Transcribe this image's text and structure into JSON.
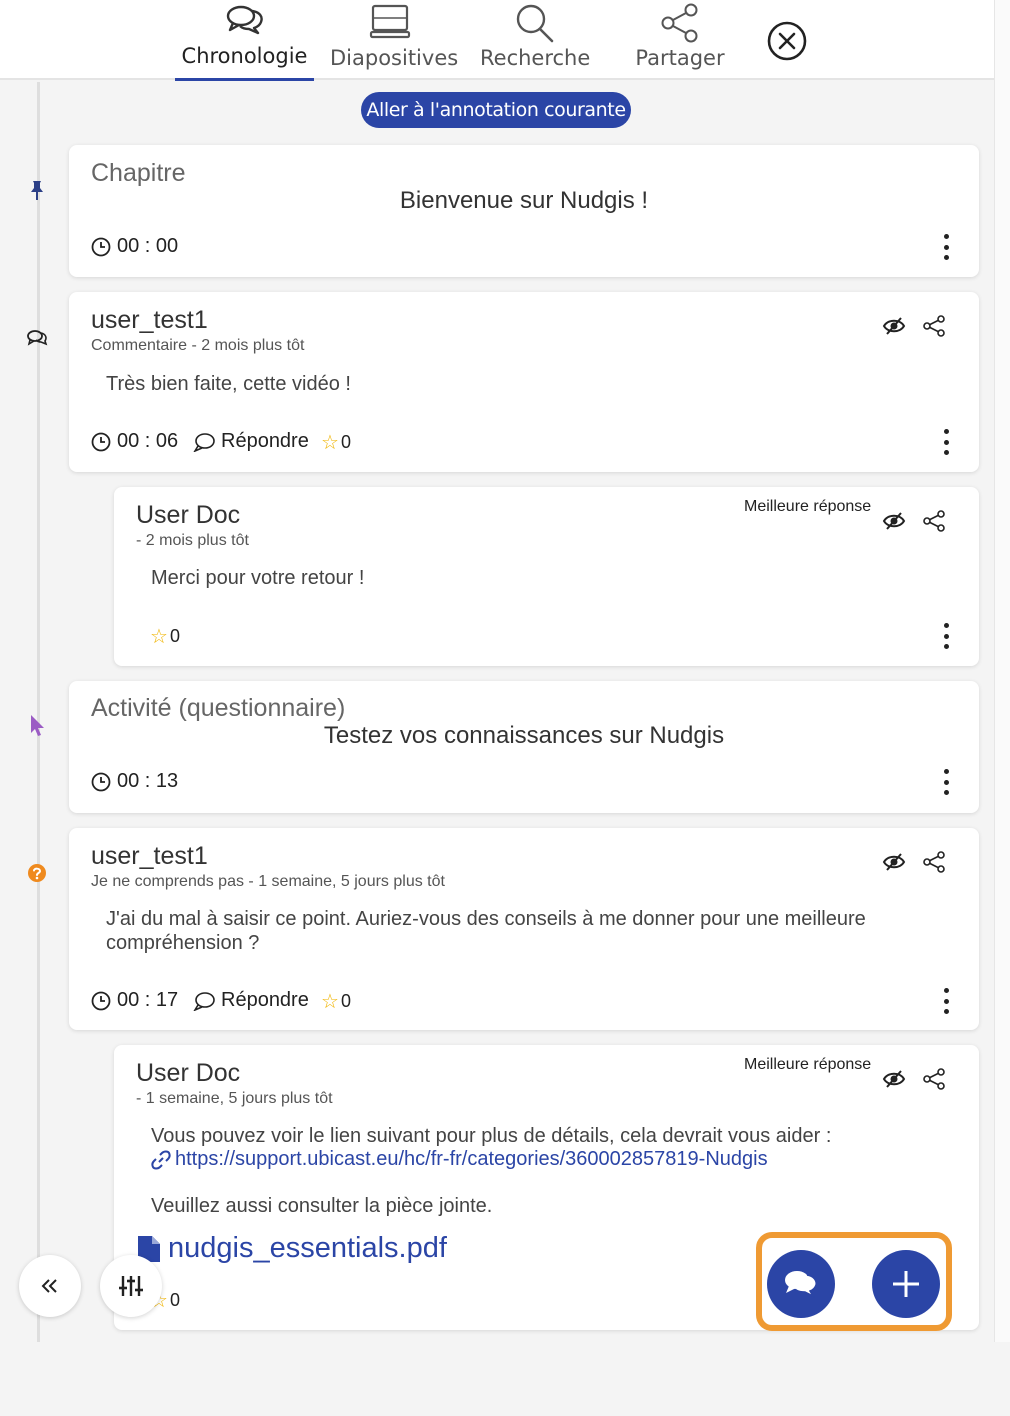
{
  "tabs": [
    {
      "label": "Chronologie",
      "icon": "comments-icon",
      "active": true
    },
    {
      "label": "Diapositives",
      "icon": "slides-icon",
      "active": false
    },
    {
      "label": "Recherche",
      "icon": "search-icon",
      "active": false
    },
    {
      "label": "Partager",
      "icon": "share-icon",
      "active": false
    }
  ],
  "goto_label": "Aller à l'annotation courante",
  "best_answer_label": "Meilleure réponse",
  "reply_label": "Répondre",
  "annotations": [
    {
      "type_label": "Chapitre",
      "title": "Bienvenue sur Nudgis !",
      "time": "00 : 00",
      "rail_icon": "pin-icon"
    },
    {
      "author": "user_test1",
      "meta": "Commentaire - 2 mois plus tôt",
      "text": "Très bien faite, cette vidéo !",
      "time": "00 : 06",
      "stars": "0",
      "rail_icon": "comment-icon"
    },
    {
      "author": "User Doc",
      "meta": "- 2 mois plus tôt",
      "text": "Merci pour votre retour !",
      "stars": "0"
    },
    {
      "type_label": "Activité (questionnaire)",
      "title": "Testez vos connaissances sur Nudgis",
      "time": "00 : 13",
      "rail_icon": "cursor-icon"
    },
    {
      "author": "user_test1",
      "meta": "Je ne comprends pas - 1 semaine, 5 jours plus tôt",
      "text": "J'ai du mal à saisir ce point. Auriez-vous des conseils à me donner pour une meilleure compréhension ?",
      "time": "00 : 17",
      "stars": "0",
      "rail_icon": "question-icon"
    },
    {
      "author": "User Doc",
      "meta": "- 1 semaine, 5 jours plus tôt",
      "text": "Vous pouvez voir le lien suivant pour plus de détails, cela devrait vous aider :",
      "link": "https://support.ubicast.eu/hc/fr-fr/categories/360002857819-Nudgis",
      "text2": "Veuillez aussi consulter la pièce jointe.",
      "attachment": "nudgis_essentials.pdf",
      "stars": "0"
    }
  ],
  "colors": {
    "accent": "#2b45a6",
    "highlight": "#ef9a33",
    "star": "#f0b400",
    "question": "#ef8a1e",
    "cursor": "#9b5cc4"
  }
}
